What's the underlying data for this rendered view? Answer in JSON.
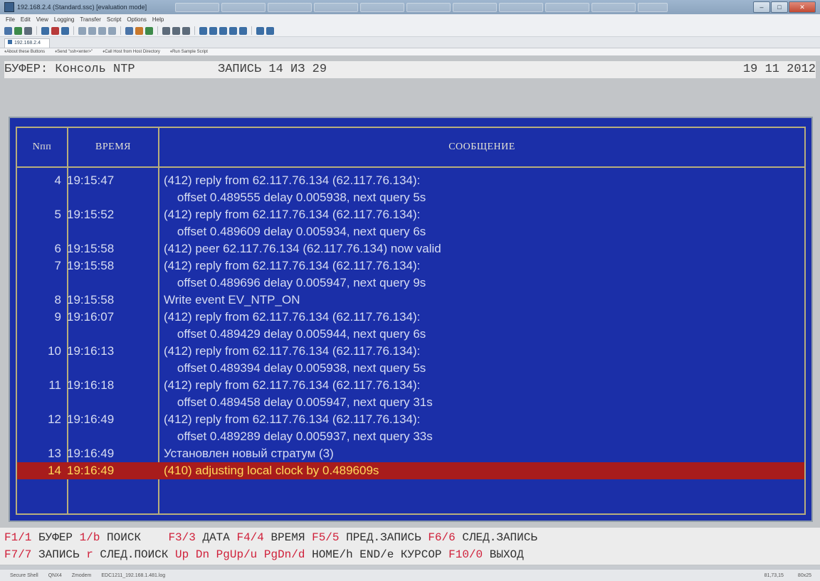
{
  "window": {
    "title": "192.168.2.4 (Standard.ssc) [evaluation mode]",
    "controls": {
      "minimize": "–",
      "maximize": "□",
      "close": "✕"
    }
  },
  "menu": [
    "File",
    "Edit",
    "View",
    "Logging",
    "Transfer",
    "Script",
    "Options",
    "Help"
  ],
  "tab": {
    "label": "192.168.2.4"
  },
  "button_bar": [
    "About these Buttons",
    "Send \"ssh<enter>\"",
    "Call Host from Host Directory",
    "Run Sample Script"
  ],
  "header": {
    "buffer": "БУФЕР: Консоль NTP",
    "record": "ЗАПИСЬ  14 ИЗ  29",
    "date": "19 11 2012"
  },
  "table": {
    "columns": {
      "num": "Nпп",
      "time": "ВРЕМЯ",
      "message": "СООБЩЕНИЕ"
    },
    "rows": [
      {
        "num": "4",
        "time": "19:15:47",
        "msg": "(412) reply from 62.117.76.134 (62.117.76.134):"
      },
      {
        "num": "",
        "time": "",
        "msg": "    offset 0.489555 delay 0.005938, next query 5s"
      },
      {
        "num": "5",
        "time": "19:15:52",
        "msg": "(412) reply from 62.117.76.134 (62.117.76.134):"
      },
      {
        "num": "",
        "time": "",
        "msg": "    offset 0.489609 delay 0.005934, next query 6s"
      },
      {
        "num": "6",
        "time": "19:15:58",
        "msg": "(412) peer 62.117.76.134 (62.117.76.134) now valid"
      },
      {
        "num": "7",
        "time": "19:15:58",
        "msg": "(412) reply from 62.117.76.134 (62.117.76.134):"
      },
      {
        "num": "",
        "time": "",
        "msg": "    offset 0.489696 delay 0.005947, next query 9s"
      },
      {
        "num": "8",
        "time": "19:15:58",
        "msg": "Write event EV_NTP_ON"
      },
      {
        "num": "9",
        "time": "19:16:07",
        "msg": "(412) reply from 62.117.76.134 (62.117.76.134):"
      },
      {
        "num": "",
        "time": "",
        "msg": "    offset 0.489429 delay 0.005944, next query 6s"
      },
      {
        "num": "10",
        "time": "19:16:13",
        "msg": "(412) reply from 62.117.76.134 (62.117.76.134):"
      },
      {
        "num": "",
        "time": "",
        "msg": "    offset 0.489394 delay 0.005938, next query 5s"
      },
      {
        "num": "11",
        "time": "19:16:18",
        "msg": "(412) reply from 62.117.76.134 (62.117.76.134):"
      },
      {
        "num": "",
        "time": "",
        "msg": "    offset 0.489458 delay 0.005947, next query 31s"
      },
      {
        "num": "12",
        "time": "19:16:49",
        "msg": "(412) reply from 62.117.76.134 (62.117.76.134):"
      },
      {
        "num": "",
        "time": "",
        "msg": "    offset 0.489289 delay 0.005937, next query 33s"
      },
      {
        "num": "13",
        "time": "19:16:49",
        "msg": "Установлен новый стратум (3)"
      },
      {
        "num": "14",
        "time": "19:16:49",
        "msg": "(410) adjusting local clock by 0.489609s",
        "selected": true
      }
    ]
  },
  "keys": {
    "line1": [
      {
        "k": "F1/1",
        "t": " БУФЕР "
      },
      {
        "k": "1/b",
        "t": " ПОИСК    "
      },
      {
        "k": "F3/3",
        "t": " ДАТА "
      },
      {
        "k": "F4/4",
        "t": " ВРЕМЯ "
      },
      {
        "k": "F5/5",
        "t": " ПРЕД.ЗАПИСЬ "
      },
      {
        "k": "F6/6",
        "t": " СЛЕД.ЗАПИСЬ"
      }
    ],
    "line2": [
      {
        "k": "F7/7",
        "t": " ЗАПИСЬ "
      },
      {
        "k": "r",
        "t": " СЛЕД.ПОИСК "
      },
      {
        "k": "Up Dn PgUp/u PgDn/d",
        "t": " HOME/h END/e КУРСОР "
      },
      {
        "k": "F10/0",
        "t": " ВЫХОД"
      }
    ]
  },
  "statusbar": {
    "items": [
      "Secure Shell",
      "QNX4",
      "Zmodem",
      "EDC1211_192.168.1.481.log"
    ],
    "pos": "81,73,15",
    "size": "80x25"
  }
}
